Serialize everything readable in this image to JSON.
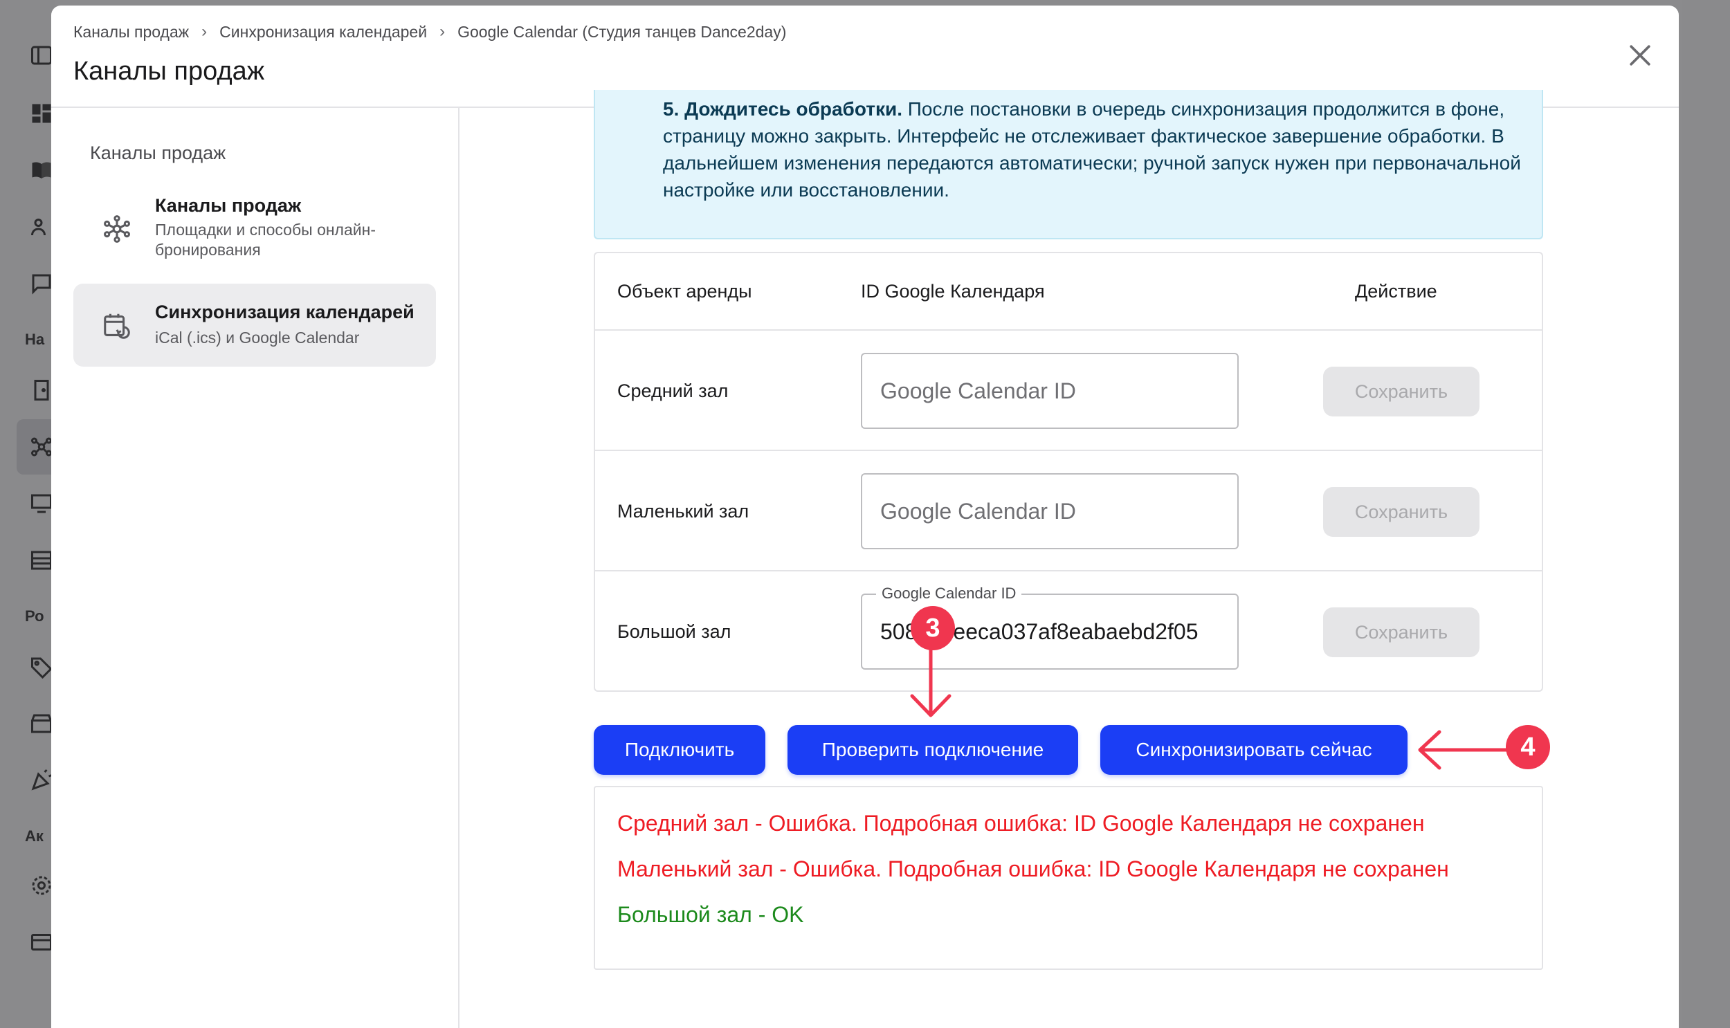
{
  "colors": {
    "primary": "#1b3ef5",
    "error": "#ee1c24",
    "success": "#1c8a1c",
    "info_bg": "#e3f5fc",
    "annotation": "#f0364f"
  },
  "background_rail": {
    "sections": [
      "На",
      "Ро",
      "Ак"
    ],
    "icons": [
      "layout-icon",
      "dashboard-icon",
      "book-icon",
      "users-icon",
      "chat-icon",
      "door-icon",
      "network-icon",
      "monitor-icon",
      "table-icon",
      "tag-icon",
      "store-icon",
      "party-icon",
      "gear-icon",
      "card-icon"
    ]
  },
  "breadcrumb": [
    "Каналы продаж",
    "Синхронизация календарей",
    "Google Calendar (Студия танцев Dance2day)"
  ],
  "page_title": "Каналы продаж",
  "sidebar": {
    "heading": "Каналы продаж",
    "items": [
      {
        "title": "Каналы продаж",
        "subtitle": "Площадки и способы онлайн-бронирования",
        "icon": "network-icon",
        "active": false
      },
      {
        "title": "Синхронизация календарей",
        "subtitle": "iCal (.ics) и Google Calendar",
        "icon": "calendar-sync-icon",
        "active": true
      }
    ]
  },
  "info": {
    "step_bold": "5. Дождитесь обработки.",
    "step_text": " После постановки в очередь синхронизация продолжится в фоне, страницу можно закрыть. Интерфейс не отслеживает фактическое завершение обработки. В дальнейшем изменения передаются автоматически; ручной запуск нужен при первоначальной настройке или восстановлении."
  },
  "table": {
    "headers": [
      "Объект аренды",
      "ID Google Календаря",
      "Действие"
    ],
    "rows": [
      {
        "name": "Средний зал",
        "value": "",
        "placeholder": "Google Calendar ID",
        "action": "Сохранить"
      },
      {
        "name": "Маленький зал",
        "value": "",
        "placeholder": "Google Calendar ID",
        "action": "Сохранить"
      },
      {
        "name": "Большой зал",
        "value": "508",
        "value_tail": "eeca037af8eabaebd2f05",
        "label": "Google Calendar ID",
        "action": "Сохранить"
      }
    ]
  },
  "buttons": {
    "connect": "Подключить",
    "check": "Проверить подключение",
    "sync": "Синхронизировать сейчас"
  },
  "results": [
    {
      "text": "Средний зал - Ошибка. Подробная ошибка: ID Google Календаря не сохранен",
      "status": "error"
    },
    {
      "text": "Маленький зал - Ошибка. Подробная ошибка: ID Google Календаря не сохранен",
      "status": "error"
    },
    {
      "text": "Большой зал - OK",
      "status": "success"
    }
  ],
  "annotations": {
    "step3": "3",
    "step4": "4"
  }
}
